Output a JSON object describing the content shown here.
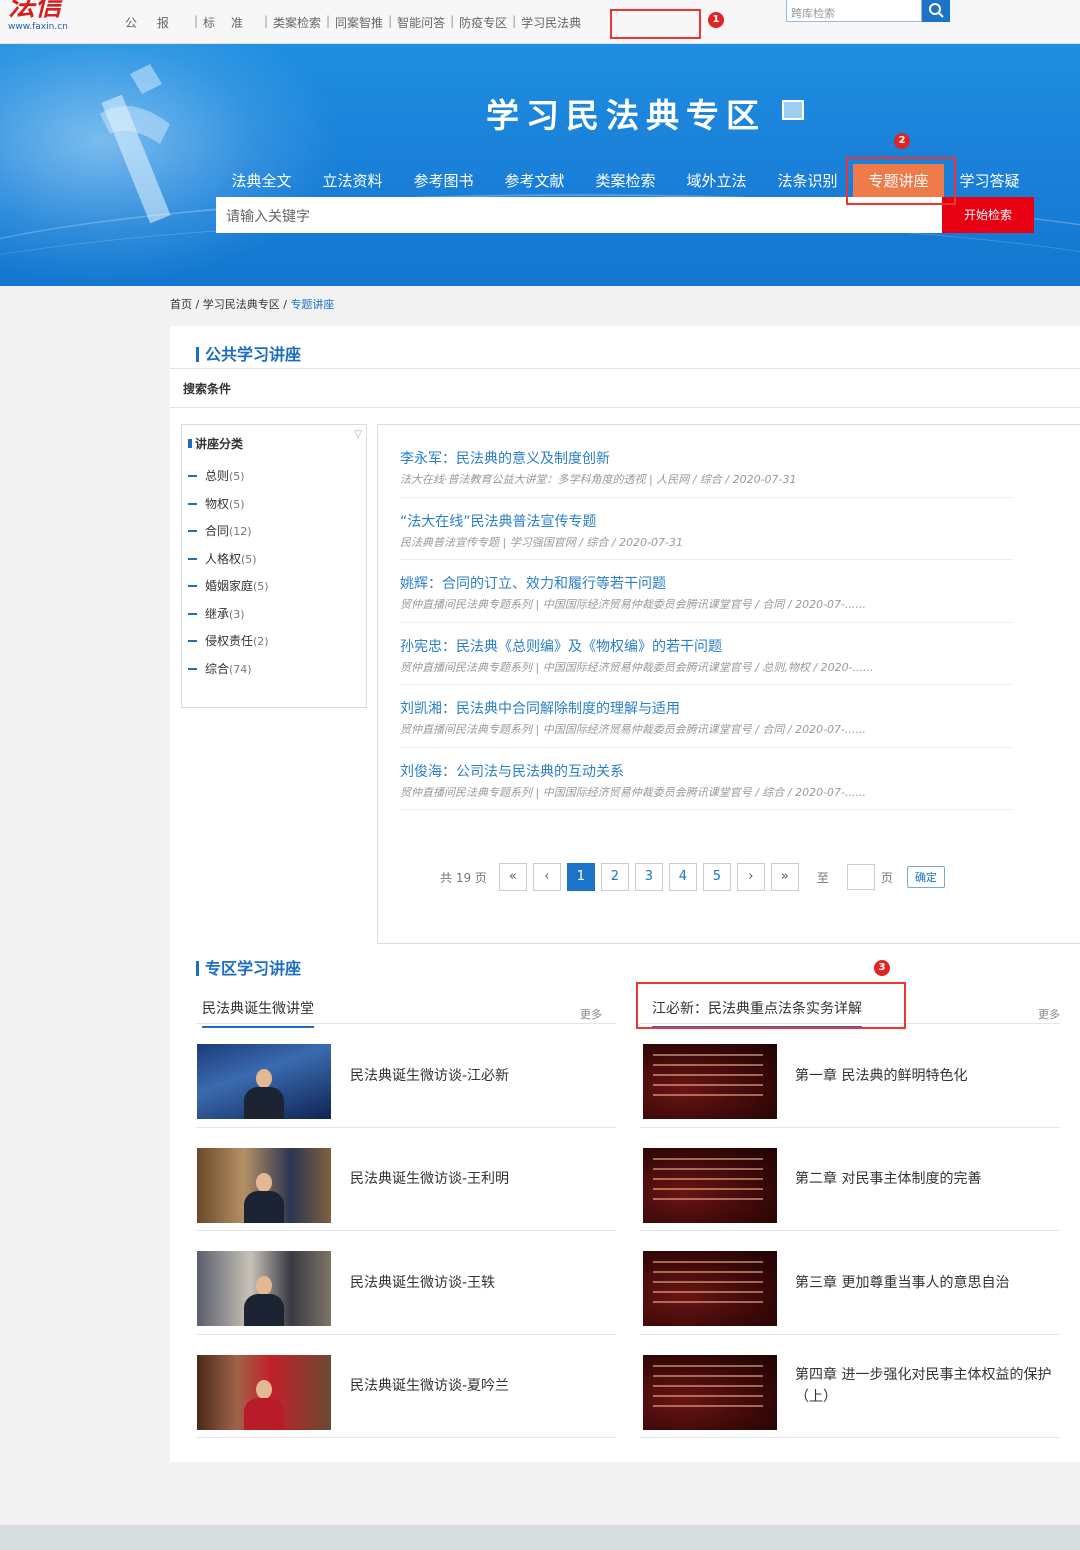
{
  "logo": {
    "name": "法信",
    "url": "www.faxin.cn"
  },
  "top_nav": {
    "items": [
      "公报",
      "标准",
      "类案检索",
      "同案智推",
      "智能问答",
      "防疫专区",
      "学习民法典"
    ],
    "search_placeholder": "跨库检索"
  },
  "annotations": {
    "step1": "1",
    "step2": "2",
    "step3": "3"
  },
  "banner": {
    "title": "学习民法典专区",
    "tabs": [
      "法典全文",
      "立法资料",
      "参考图书",
      "参考文献",
      "类案检索",
      "域外立法",
      "法条识别",
      "专题讲座",
      "学习答疑"
    ],
    "active_tab": "专题讲座",
    "search_placeholder": "请输入关键字",
    "search_button": "开始检索"
  },
  "breadcrumb": {
    "home": "首页",
    "sep1": "/",
    "section": "学习民法典专区",
    "sep2": "/",
    "current": "专题讲座"
  },
  "public_lectures": {
    "title": "公共学习讲座",
    "search_conditions": "搜索条件",
    "categories_title": "讲座分类",
    "categories": [
      {
        "name": "总则",
        "count": "(5)"
      },
      {
        "name": "物权",
        "count": "(5)"
      },
      {
        "name": "合同",
        "count": "(12)"
      },
      {
        "name": "人格权",
        "count": "(5)"
      },
      {
        "name": "婚姻家庭",
        "count": "(5)"
      },
      {
        "name": "继承",
        "count": "(3)"
      },
      {
        "name": "侵权责任",
        "count": "(2)"
      },
      {
        "name": "综合",
        "count": "(74)"
      }
    ],
    "lectures": [
      {
        "title": "李永军：民法典的意义及制度创新",
        "meta": "法大在线·普法教育公益大讲堂：多学科角度的透视 | 人民网 / 综合 / 2020-07-31"
      },
      {
        "title": "“法大在线”民法典普法宣传专题",
        "meta": "民法典普法宣传专题 | 学习强国官网 / 综合 / 2020-07-31"
      },
      {
        "title": "姚辉：合同的订立、效力和履行等若干问题",
        "meta": "贸仲直播间民法典专题系列 | 中国国际经济贸易仲裁委员会腾讯课堂官号 / 合同 / 2020-07-......"
      },
      {
        "title": "孙宪忠：民法典《总则编》及《物权编》的若干问题",
        "meta": "贸仲直播间民法典专题系列 | 中国国际经济贸易仲裁委员会腾讯课堂官号 / 总则,物权 / 2020-......"
      },
      {
        "title": "刘凯湘：民法典中合同解除制度的理解与适用",
        "meta": "贸仲直播间民法典专题系列 | 中国国际经济贸易仲裁委员会腾讯课堂官号 / 合同 / 2020-07-......"
      },
      {
        "title": "刘俊海：公司法与民法典的互动关系",
        "meta": "贸仲直播间民法典专题系列 | 中国国际经济贸易仲裁委员会腾讯课堂官号 / 综合 / 2020-07-......"
      }
    ],
    "pagination": {
      "total_text": "共 19 页",
      "first": "«",
      "prev": "‹",
      "pages": [
        "1",
        "2",
        "3",
        "4",
        "5"
      ],
      "current": "1",
      "next": "›",
      "last": "»",
      "goto_label": "至",
      "page_unit": "页",
      "confirm": "确定"
    }
  },
  "zone_lectures": {
    "title": "专区学习讲座",
    "more": "更多",
    "left": {
      "tab": "民法典诞生微讲堂",
      "items": [
        "民法典诞生微访谈-江必新",
        "民法典诞生微访谈-王利明",
        "民法典诞生微访谈-王轶",
        "民法典诞生微访谈-夏吟兰"
      ]
    },
    "right": {
      "tab": "江必新：民法典重点法条实务详解",
      "items": [
        "第一章 民法典的鲜明特色化",
        "第二章 对民事主体制度的完善",
        "第三章 更加尊重当事人的意思自治",
        "第四章 进一步强化对民事主体权益的保护（上）"
      ]
    }
  },
  "colors": {
    "accent": "#1b74c8",
    "banner": "#1a7fd8",
    "active_tab": "#f07b4a",
    "search_button": "#e60012",
    "highlight": "#e33333"
  }
}
